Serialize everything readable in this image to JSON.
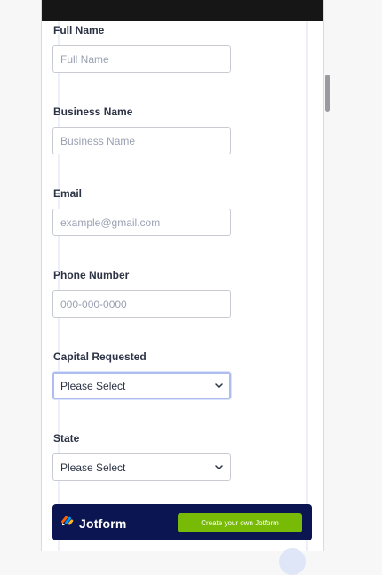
{
  "form": {
    "fields": [
      {
        "label": "Full Name",
        "placeholder": "Full Name"
      },
      {
        "label": "Business Name",
        "placeholder": "Business Name"
      },
      {
        "label": "Email",
        "placeholder": "example@gmail.com"
      },
      {
        "label": "Phone Number",
        "placeholder": "000-000-0000"
      },
      {
        "label": "Capital Requested",
        "value": "Please Select"
      },
      {
        "label": "State",
        "value": "Please Select"
      }
    ]
  },
  "banner": {
    "brand": "Jotform",
    "cta": "Create your own Jotform"
  },
  "colors": {
    "banner_bg": "#0a1551",
    "cta_bg": "#78bb07",
    "focus_border": "#aebcf0"
  },
  "icons": {
    "dropdown": "chevron-down-icon",
    "logo": "jotform-logo-icon"
  }
}
